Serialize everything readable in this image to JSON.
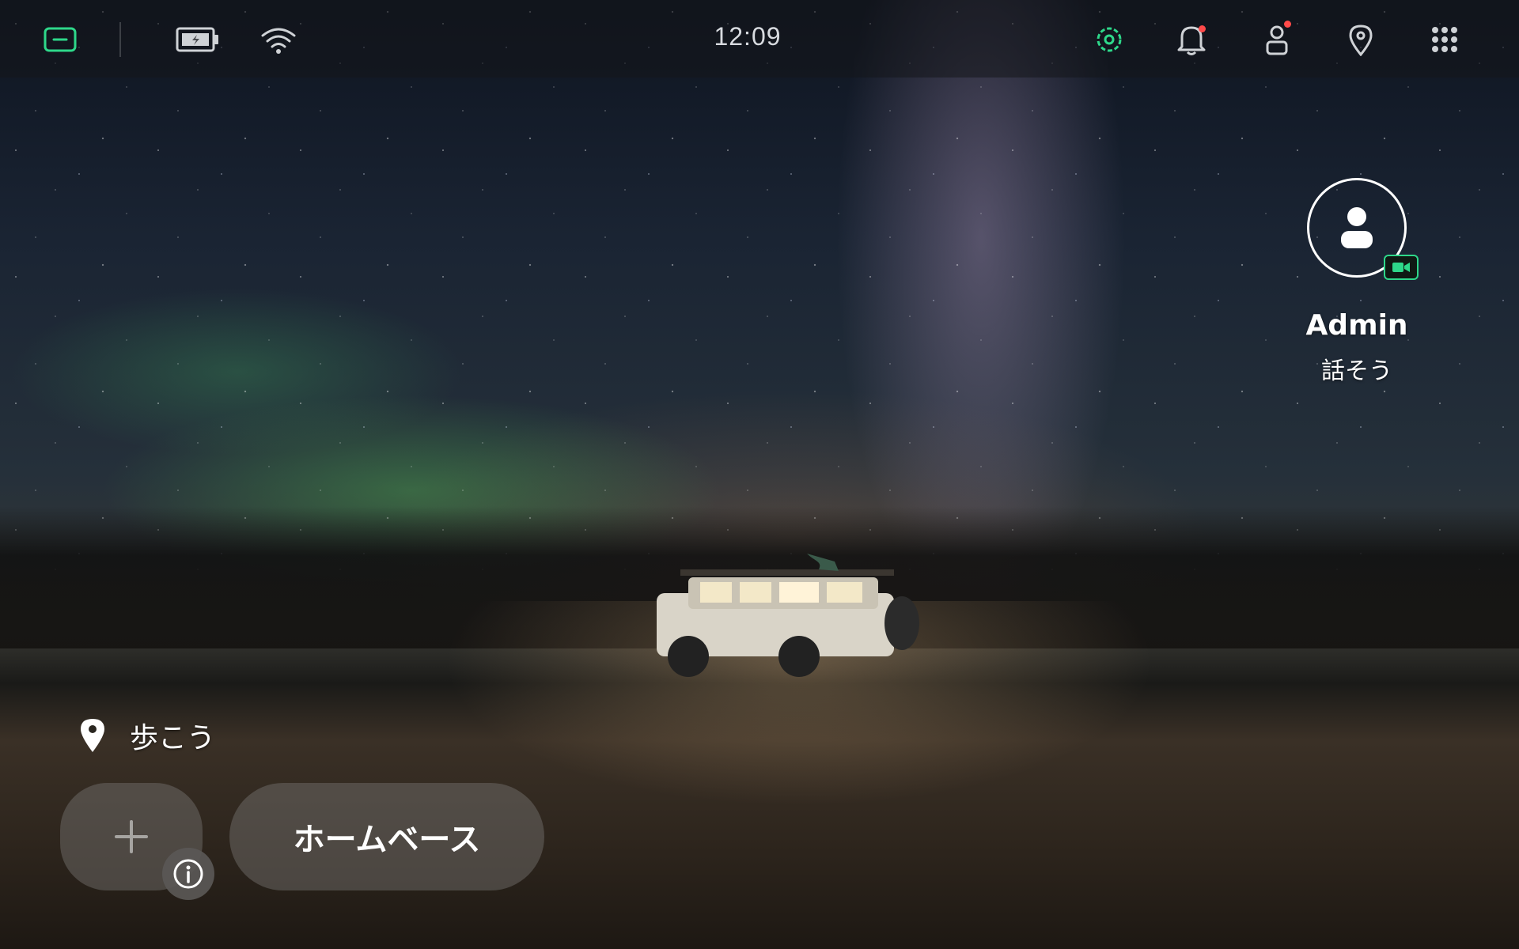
{
  "statusbar": {
    "time": "12:09",
    "icons": [
      "screen-mode-icon",
      "battery-icon",
      "wifi-icon",
      "settings-icon",
      "bell-icon",
      "account-icon",
      "location-pin-icon",
      "apps-grid-icon"
    ],
    "accent_color": "#2ed88a",
    "badge_color": "#ff4a4a",
    "notification_badge": true,
    "account_badge": true
  },
  "contact": {
    "name": "Admin",
    "action": "話そう",
    "video_badge_color": "#2ed88a"
  },
  "location": {
    "label": "歩こう"
  },
  "bottom": {
    "add_icon": "plus-icon",
    "info_icon": "info-icon",
    "home_label": "ホームベース"
  },
  "wallpaper": {
    "description_icon": "wallpaper"
  }
}
